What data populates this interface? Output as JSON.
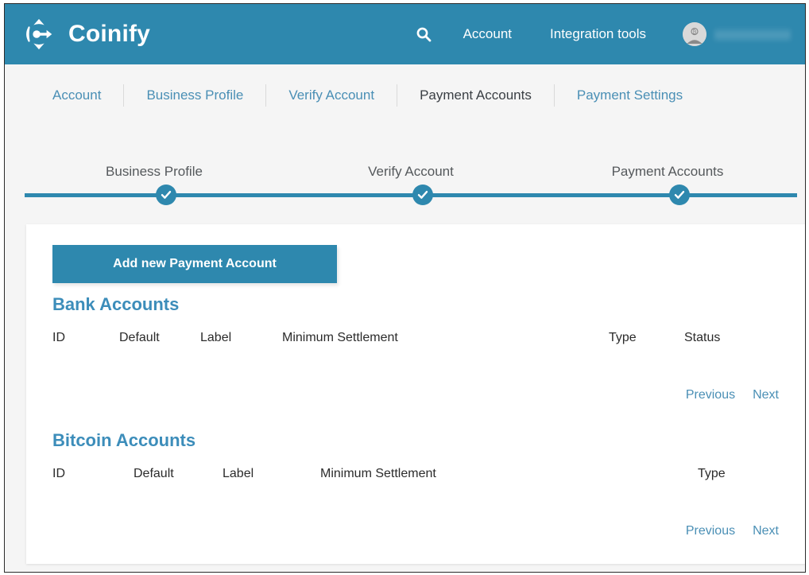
{
  "brand": {
    "name": "Coinify",
    "logo_icon": "coinify-compass-icon"
  },
  "topnav": {
    "search_icon": "search-icon",
    "links": [
      {
        "label": "Account"
      },
      {
        "label": "Integration tools"
      }
    ],
    "user": {
      "avatar_icon": "user-avatar-bitcoin-icon",
      "name": ""
    }
  },
  "subnav": {
    "items": [
      {
        "label": "Account",
        "active": false
      },
      {
        "label": "Business Profile",
        "active": false
      },
      {
        "label": "Verify Account",
        "active": false
      },
      {
        "label": "Payment Accounts",
        "active": true
      },
      {
        "label": "Payment Settings",
        "active": false
      }
    ]
  },
  "stepper": {
    "steps": [
      {
        "label": "Business Profile",
        "complete": true
      },
      {
        "label": "Verify Account",
        "complete": true
      },
      {
        "label": "Payment Accounts",
        "complete": true
      }
    ],
    "check_icon": "check-icon",
    "line_color": "#2e88ae"
  },
  "main": {
    "add_button_label": "Add new Payment Account",
    "bank_section": {
      "title": "Bank Accounts",
      "columns": [
        "ID",
        "Default",
        "Label",
        "Minimum Settlement",
        "Type",
        "Status"
      ],
      "rows": [],
      "pager": {
        "previous": "Previous",
        "next": "Next"
      }
    },
    "bitcoin_section": {
      "title": "Bitcoin Accounts",
      "columns": [
        "ID",
        "Default",
        "Label",
        "Minimum Settlement",
        "Type"
      ],
      "rows": [],
      "pager": {
        "previous": "Previous",
        "next": "Next"
      }
    }
  },
  "colors": {
    "brand_teal": "#2e88ae",
    "link_blue": "#4a8fb5",
    "page_bg": "#f5f5f5",
    "card_bg": "#ffffff",
    "text_dark": "#2b2b2b"
  }
}
